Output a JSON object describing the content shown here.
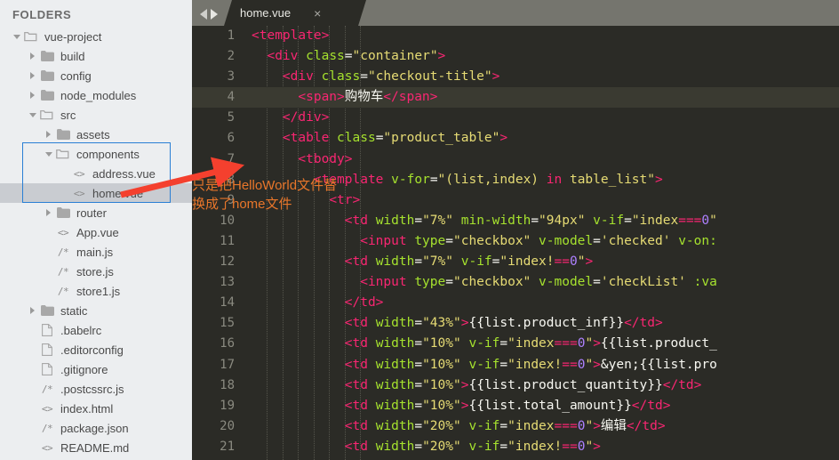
{
  "sidebar": {
    "header": "FOLDERS",
    "tree": [
      {
        "label": "vue-project",
        "type": "folder-open",
        "depth": 0,
        "arrow": "open",
        "selected": false
      },
      {
        "label": "build",
        "type": "folder",
        "depth": 1,
        "arrow": "closed",
        "selected": false
      },
      {
        "label": "config",
        "type": "folder",
        "depth": 1,
        "arrow": "closed",
        "selected": false
      },
      {
        "label": "node_modules",
        "type": "folder",
        "depth": 1,
        "arrow": "closed",
        "selected": false
      },
      {
        "label": "src",
        "type": "folder-open",
        "depth": 1,
        "arrow": "open",
        "selected": false
      },
      {
        "label": "assets",
        "type": "folder",
        "depth": 2,
        "arrow": "closed",
        "selected": false
      },
      {
        "label": "components",
        "type": "folder-open",
        "depth": 2,
        "arrow": "open",
        "selected": false
      },
      {
        "label": "address.vue",
        "type": "code",
        "depth": 3,
        "arrow": "none",
        "selected": false
      },
      {
        "label": "home.vue",
        "type": "code",
        "depth": 3,
        "arrow": "none",
        "selected": true
      },
      {
        "label": "router",
        "type": "folder",
        "depth": 2,
        "arrow": "closed",
        "selected": false
      },
      {
        "label": "App.vue",
        "type": "code",
        "depth": 2,
        "arrow": "none",
        "selected": false
      },
      {
        "label": "main.js",
        "type": "js",
        "depth": 2,
        "arrow": "none",
        "selected": false
      },
      {
        "label": "store.js",
        "type": "js",
        "depth": 2,
        "arrow": "none",
        "selected": false
      },
      {
        "label": "store1.js",
        "type": "js",
        "depth": 2,
        "arrow": "none",
        "selected": false
      },
      {
        "label": "static",
        "type": "folder",
        "depth": 1,
        "arrow": "closed",
        "selected": false
      },
      {
        "label": ".babelrc",
        "type": "file",
        "depth": 1,
        "arrow": "none",
        "selected": false
      },
      {
        "label": ".editorconfig",
        "type": "file",
        "depth": 1,
        "arrow": "none",
        "selected": false
      },
      {
        "label": ".gitignore",
        "type": "file",
        "depth": 1,
        "arrow": "none",
        "selected": false
      },
      {
        "label": ".postcssrc.js",
        "type": "js",
        "depth": 1,
        "arrow": "none",
        "selected": false
      },
      {
        "label": "index.html",
        "type": "code",
        "depth": 1,
        "arrow": "none",
        "selected": false
      },
      {
        "label": "package.json",
        "type": "js",
        "depth": 1,
        "arrow": "none",
        "selected": false
      },
      {
        "label": "README.md",
        "type": "code",
        "depth": 1,
        "arrow": "none",
        "selected": false
      }
    ],
    "highlight_color": "#2a7fd4"
  },
  "editor": {
    "tab": {
      "title": "home.vue",
      "close": "×"
    },
    "nav": {
      "back": "back-arrow",
      "forward": "forward-arrow"
    },
    "current_line": 4,
    "lines": [
      {
        "n": 1,
        "tokens": [
          [
            "p",
            "<template>"
          ]
        ]
      },
      {
        "n": 2,
        "tokens": [
          [
            "w",
            "  "
          ],
          [
            "p",
            "<div "
          ],
          [
            "a",
            "class"
          ],
          [
            "w",
            "="
          ],
          [
            "s",
            "\"container\""
          ],
          [
            "p",
            ">"
          ]
        ]
      },
      {
        "n": 3,
        "tokens": [
          [
            "w",
            "    "
          ],
          [
            "p",
            "<div "
          ],
          [
            "a",
            "class"
          ],
          [
            "w",
            "="
          ],
          [
            "s",
            "\"checkout-title\""
          ],
          [
            "p",
            ">"
          ]
        ]
      },
      {
        "n": 4,
        "tokens": [
          [
            "w",
            "      "
          ],
          [
            "p",
            "<span>"
          ],
          [
            "w",
            "购物车"
          ],
          [
            "p",
            "</span>"
          ]
        ]
      },
      {
        "n": 5,
        "tokens": [
          [
            "w",
            "    "
          ],
          [
            "p",
            "</div>"
          ]
        ]
      },
      {
        "n": 6,
        "tokens": [
          [
            "w",
            "    "
          ],
          [
            "p",
            "<table "
          ],
          [
            "a",
            "class"
          ],
          [
            "w",
            "="
          ],
          [
            "s",
            "\"product_table\""
          ],
          [
            "p",
            ">"
          ]
        ]
      },
      {
        "n": 7,
        "tokens": [
          [
            "w",
            "      "
          ],
          [
            "p",
            "<tbody>"
          ]
        ]
      },
      {
        "n": 8,
        "tokens": [
          [
            "w",
            "        "
          ],
          [
            "p",
            "<template "
          ],
          [
            "a",
            "v-for"
          ],
          [
            "w",
            "="
          ],
          [
            "s",
            "\"(list,index) "
          ],
          [
            "k",
            "in"
          ],
          [
            "s",
            " table_list\""
          ],
          [
            "p",
            ">"
          ]
        ]
      },
      {
        "n": 9,
        "tokens": [
          [
            "w",
            "          "
          ],
          [
            "p",
            "<tr>"
          ]
        ]
      },
      {
        "n": 10,
        "tokens": [
          [
            "w",
            "            "
          ],
          [
            "p",
            "<td "
          ],
          [
            "a",
            "width"
          ],
          [
            "w",
            "="
          ],
          [
            "s",
            "\"7%\""
          ],
          [
            "w",
            " "
          ],
          [
            "a",
            "min-width"
          ],
          [
            "w",
            "="
          ],
          [
            "s",
            "\"94px\""
          ],
          [
            "w",
            " "
          ],
          [
            "a",
            "v-if"
          ],
          [
            "w",
            "="
          ],
          [
            "s",
            "\"index"
          ],
          [
            "p",
            "==="
          ],
          [
            "n",
            "0"
          ],
          [
            "s",
            "\""
          ]
        ]
      },
      {
        "n": 11,
        "tokens": [
          [
            "w",
            "              "
          ],
          [
            "p",
            "<input "
          ],
          [
            "a",
            "type"
          ],
          [
            "w",
            "="
          ],
          [
            "s",
            "\"checkbox\""
          ],
          [
            "w",
            " "
          ],
          [
            "a",
            "v-model"
          ],
          [
            "w",
            "="
          ],
          [
            "s",
            "'checked'"
          ],
          [
            "w",
            " "
          ],
          [
            "a",
            "v-on:"
          ]
        ]
      },
      {
        "n": 12,
        "tokens": [
          [
            "w",
            "            "
          ],
          [
            "p",
            "<td "
          ],
          [
            "a",
            "width"
          ],
          [
            "w",
            "="
          ],
          [
            "s",
            "\"7%\""
          ],
          [
            "w",
            " "
          ],
          [
            "a",
            "v-if"
          ],
          [
            "w",
            "="
          ],
          [
            "s",
            "\"index!"
          ],
          [
            "p",
            "=="
          ],
          [
            "n",
            "0"
          ],
          [
            "s",
            "\""
          ],
          [
            "p",
            ">"
          ]
        ]
      },
      {
        "n": 13,
        "tokens": [
          [
            "w",
            "              "
          ],
          [
            "p",
            "<input "
          ],
          [
            "a",
            "type"
          ],
          [
            "w",
            "="
          ],
          [
            "s",
            "\"checkbox\""
          ],
          [
            "w",
            " "
          ],
          [
            "a",
            "v-model"
          ],
          [
            "w",
            "="
          ],
          [
            "s",
            "'checkList'"
          ],
          [
            "w",
            " "
          ],
          [
            "a",
            ":va"
          ]
        ]
      },
      {
        "n": 14,
        "tokens": [
          [
            "w",
            "            "
          ],
          [
            "p",
            "</td>"
          ]
        ]
      },
      {
        "n": 15,
        "tokens": [
          [
            "w",
            "            "
          ],
          [
            "p",
            "<td "
          ],
          [
            "a",
            "width"
          ],
          [
            "w",
            "="
          ],
          [
            "s",
            "\"43%\""
          ],
          [
            "p",
            ">"
          ],
          [
            "w",
            "{{list.product_inf}}"
          ],
          [
            "p",
            "</td>"
          ]
        ]
      },
      {
        "n": 16,
        "tokens": [
          [
            "w",
            "            "
          ],
          [
            "p",
            "<td "
          ],
          [
            "a",
            "width"
          ],
          [
            "w",
            "="
          ],
          [
            "s",
            "\"10%\""
          ],
          [
            "w",
            " "
          ],
          [
            "a",
            "v-if"
          ],
          [
            "w",
            "="
          ],
          [
            "s",
            "\"index"
          ],
          [
            "p",
            "==="
          ],
          [
            "n",
            "0"
          ],
          [
            "s",
            "\""
          ],
          [
            "p",
            ">"
          ],
          [
            "w",
            "{{list.product_"
          ]
        ]
      },
      {
        "n": 17,
        "tokens": [
          [
            "w",
            "            "
          ],
          [
            "p",
            "<td "
          ],
          [
            "a",
            "width"
          ],
          [
            "w",
            "="
          ],
          [
            "s",
            "\"10%\""
          ],
          [
            "w",
            " "
          ],
          [
            "a",
            "v-if"
          ],
          [
            "w",
            "="
          ],
          [
            "s",
            "\"index!"
          ],
          [
            "p",
            "=="
          ],
          [
            "n",
            "0"
          ],
          [
            "s",
            "\""
          ],
          [
            "p",
            ">"
          ],
          [
            "w",
            "&yen;{{list.pro"
          ]
        ]
      },
      {
        "n": 18,
        "tokens": [
          [
            "w",
            "            "
          ],
          [
            "p",
            "<td "
          ],
          [
            "a",
            "width"
          ],
          [
            "w",
            "="
          ],
          [
            "s",
            "\"10%\""
          ],
          [
            "p",
            ">"
          ],
          [
            "w",
            "{{list.product_quantity}}"
          ],
          [
            "p",
            "</td>"
          ]
        ]
      },
      {
        "n": 19,
        "tokens": [
          [
            "w",
            "            "
          ],
          [
            "p",
            "<td "
          ],
          [
            "a",
            "width"
          ],
          [
            "w",
            "="
          ],
          [
            "s",
            "\"10%\""
          ],
          [
            "p",
            ">"
          ],
          [
            "w",
            "{{list.total_amount}}"
          ],
          [
            "p",
            "</td>"
          ]
        ]
      },
      {
        "n": 20,
        "tokens": [
          [
            "w",
            "            "
          ],
          [
            "p",
            "<td "
          ],
          [
            "a",
            "width"
          ],
          [
            "w",
            "="
          ],
          [
            "s",
            "\"20%\""
          ],
          [
            "w",
            " "
          ],
          [
            "a",
            "v-if"
          ],
          [
            "w",
            "="
          ],
          [
            "s",
            "\"index"
          ],
          [
            "p",
            "==="
          ],
          [
            "n",
            "0"
          ],
          [
            "s",
            "\""
          ],
          [
            "p",
            ">"
          ],
          [
            "w",
            "编辑"
          ],
          [
            "p",
            "</td>"
          ]
        ]
      },
      {
        "n": 21,
        "tokens": [
          [
            "w",
            "            "
          ],
          [
            "p",
            "<td "
          ],
          [
            "a",
            "width"
          ],
          [
            "w",
            "="
          ],
          [
            "s",
            "\"20%\""
          ],
          [
            "w",
            " "
          ],
          [
            "a",
            "v-if"
          ],
          [
            "w",
            "="
          ],
          [
            "s",
            "\"index!"
          ],
          [
            "p",
            "=="
          ],
          [
            "n",
            "0"
          ],
          [
            "s",
            "\""
          ],
          [
            "p",
            ">"
          ]
        ]
      }
    ]
  },
  "annotation": {
    "text": "只是把HelloWorld文件替换成了home文件",
    "color": "#e8762a",
    "arrow_color": "#f4402e"
  }
}
